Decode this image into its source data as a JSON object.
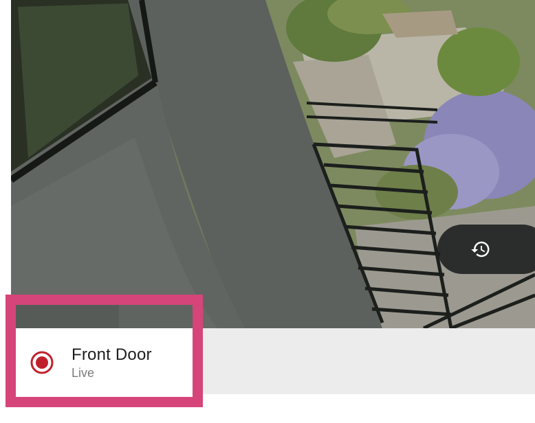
{
  "camera": {
    "name": "Front Door",
    "status": "Live"
  },
  "controls": {
    "history_icon": "history-icon",
    "record_icon": "record-indicator-icon"
  },
  "colors": {
    "highlight": "#d6457a",
    "record_red": "#c0202c",
    "info_bar": "#ececec",
    "pill": "#181a1c"
  }
}
